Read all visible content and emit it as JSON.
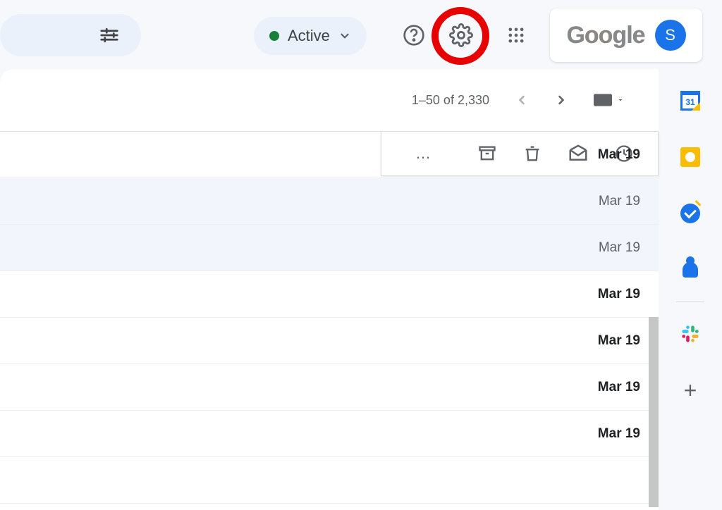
{
  "header": {
    "status_label": "Active",
    "avatar_initial": "S",
    "logo_text": "Google"
  },
  "toolbar": {
    "pagination": "1–50 of 2,330"
  },
  "rows": [
    {
      "date": "Mar 19",
      "unread": true,
      "hover": true
    },
    {
      "date": "Mar 19",
      "unread": false,
      "hover": false
    },
    {
      "date": "Mar 19",
      "unread": false,
      "hover": false
    },
    {
      "date": "Mar 19",
      "unread": true,
      "hover": false
    },
    {
      "date": "Mar 19",
      "unread": true,
      "hover": false
    },
    {
      "date": "Mar 19",
      "unread": true,
      "hover": false
    },
    {
      "date": "Mar 19",
      "unread": true,
      "hover": false
    }
  ],
  "side": {
    "calendar_day": "31"
  }
}
